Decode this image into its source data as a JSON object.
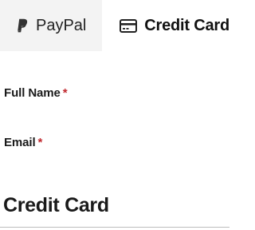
{
  "tabs": {
    "paypal": {
      "label": "PayPal",
      "icon": "paypal-icon"
    },
    "credit_card": {
      "label": "Credit Card",
      "icon": "credit-card-icon"
    }
  },
  "form": {
    "full_name": {
      "label": "Full Name",
      "required_marker": "*"
    },
    "email": {
      "label": "Email",
      "required_marker": "*"
    }
  },
  "section": {
    "title": "Credit Card"
  },
  "colors": {
    "inactive_tab_bg": "#f3f3f3",
    "active_tab_bg": "#ffffff",
    "required": "#c0272d",
    "text": "#1a1a1a"
  }
}
